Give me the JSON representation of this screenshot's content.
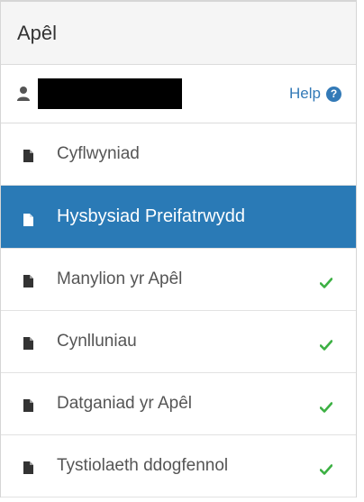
{
  "panel": {
    "title": "Apêl"
  },
  "user": {
    "name": "",
    "help_label": "Help",
    "help_icon": "question-circle-icon"
  },
  "nav": {
    "items": [
      {
        "label": "Cyflwyniad",
        "active": false,
        "complete": false,
        "icon": "file-icon"
      },
      {
        "label": "Hysbysiad Preifatrwydd",
        "active": true,
        "complete": false,
        "icon": "file-icon"
      },
      {
        "label": "Manylion yr Apêl",
        "active": false,
        "complete": true,
        "icon": "file-icon"
      },
      {
        "label": "Cynlluniau",
        "active": false,
        "complete": true,
        "icon": "file-icon"
      },
      {
        "label": "Datganiad yr Apêl",
        "active": false,
        "complete": true,
        "icon": "file-icon"
      },
      {
        "label": "Tystiolaeth ddogfennol",
        "active": false,
        "complete": true,
        "icon": "file-icon"
      }
    ]
  },
  "colors": {
    "active_bg": "#2a7ab6",
    "check": "#3cb043",
    "link": "#337ab7"
  }
}
